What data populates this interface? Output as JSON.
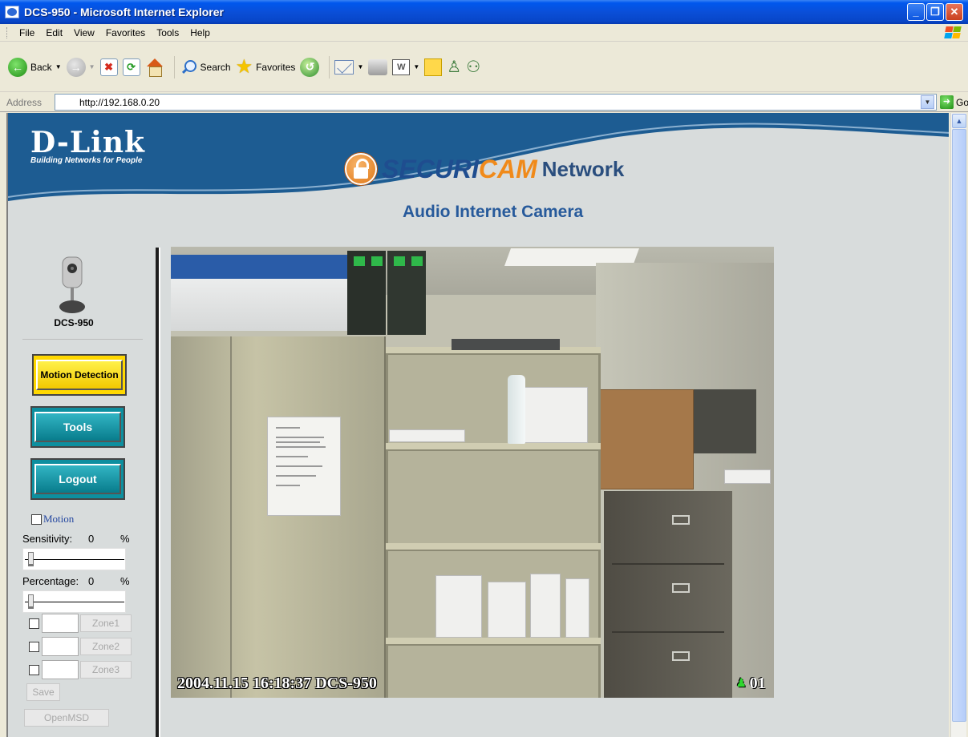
{
  "window": {
    "title": "DCS-950 - Microsoft Internet Explorer"
  },
  "menubar": {
    "items": [
      "File",
      "Edit",
      "View",
      "Favorites",
      "Tools",
      "Help"
    ]
  },
  "toolbar": {
    "back_label": "Back",
    "search_label": "Search",
    "favorites_label": "Favorites"
  },
  "addressbar": {
    "label": "Address",
    "url": "http://192.168.0.20",
    "go_label": "Go"
  },
  "header": {
    "brand_name": "D-Link",
    "brand_tagline": "Building Networks for People",
    "product_line_part1": "SECURI",
    "product_line_part2": "CAM",
    "product_line_part3": "Network",
    "product_title": "Audio Internet Camera"
  },
  "left_panel": {
    "camera_name": "DCS-950",
    "motion_detection_button": "Motion Detection",
    "tools_button": "Tools",
    "logout_button": "Logout",
    "motion_label": "Motion",
    "sensitivity": {
      "label": "Sensitivity:",
      "value": "0",
      "unit": "%"
    },
    "percentage": {
      "label": "Percentage:",
      "value": "0",
      "unit": "%"
    },
    "zones": [
      {
        "label": "Zone1",
        "value": ""
      },
      {
        "label": "Zone2",
        "value": ""
      },
      {
        "label": "Zone3",
        "value": ""
      }
    ],
    "save_button": "Save",
    "openmsd_button": "OpenMSD"
  },
  "video": {
    "overlay_text": "2004.11.15 16:18:37 DCS-950",
    "channel": "01"
  },
  "colors": {
    "header_blue": "#1f5a8f",
    "motion_button": "#ffd800",
    "tools_button": "#0d8f9f"
  }
}
